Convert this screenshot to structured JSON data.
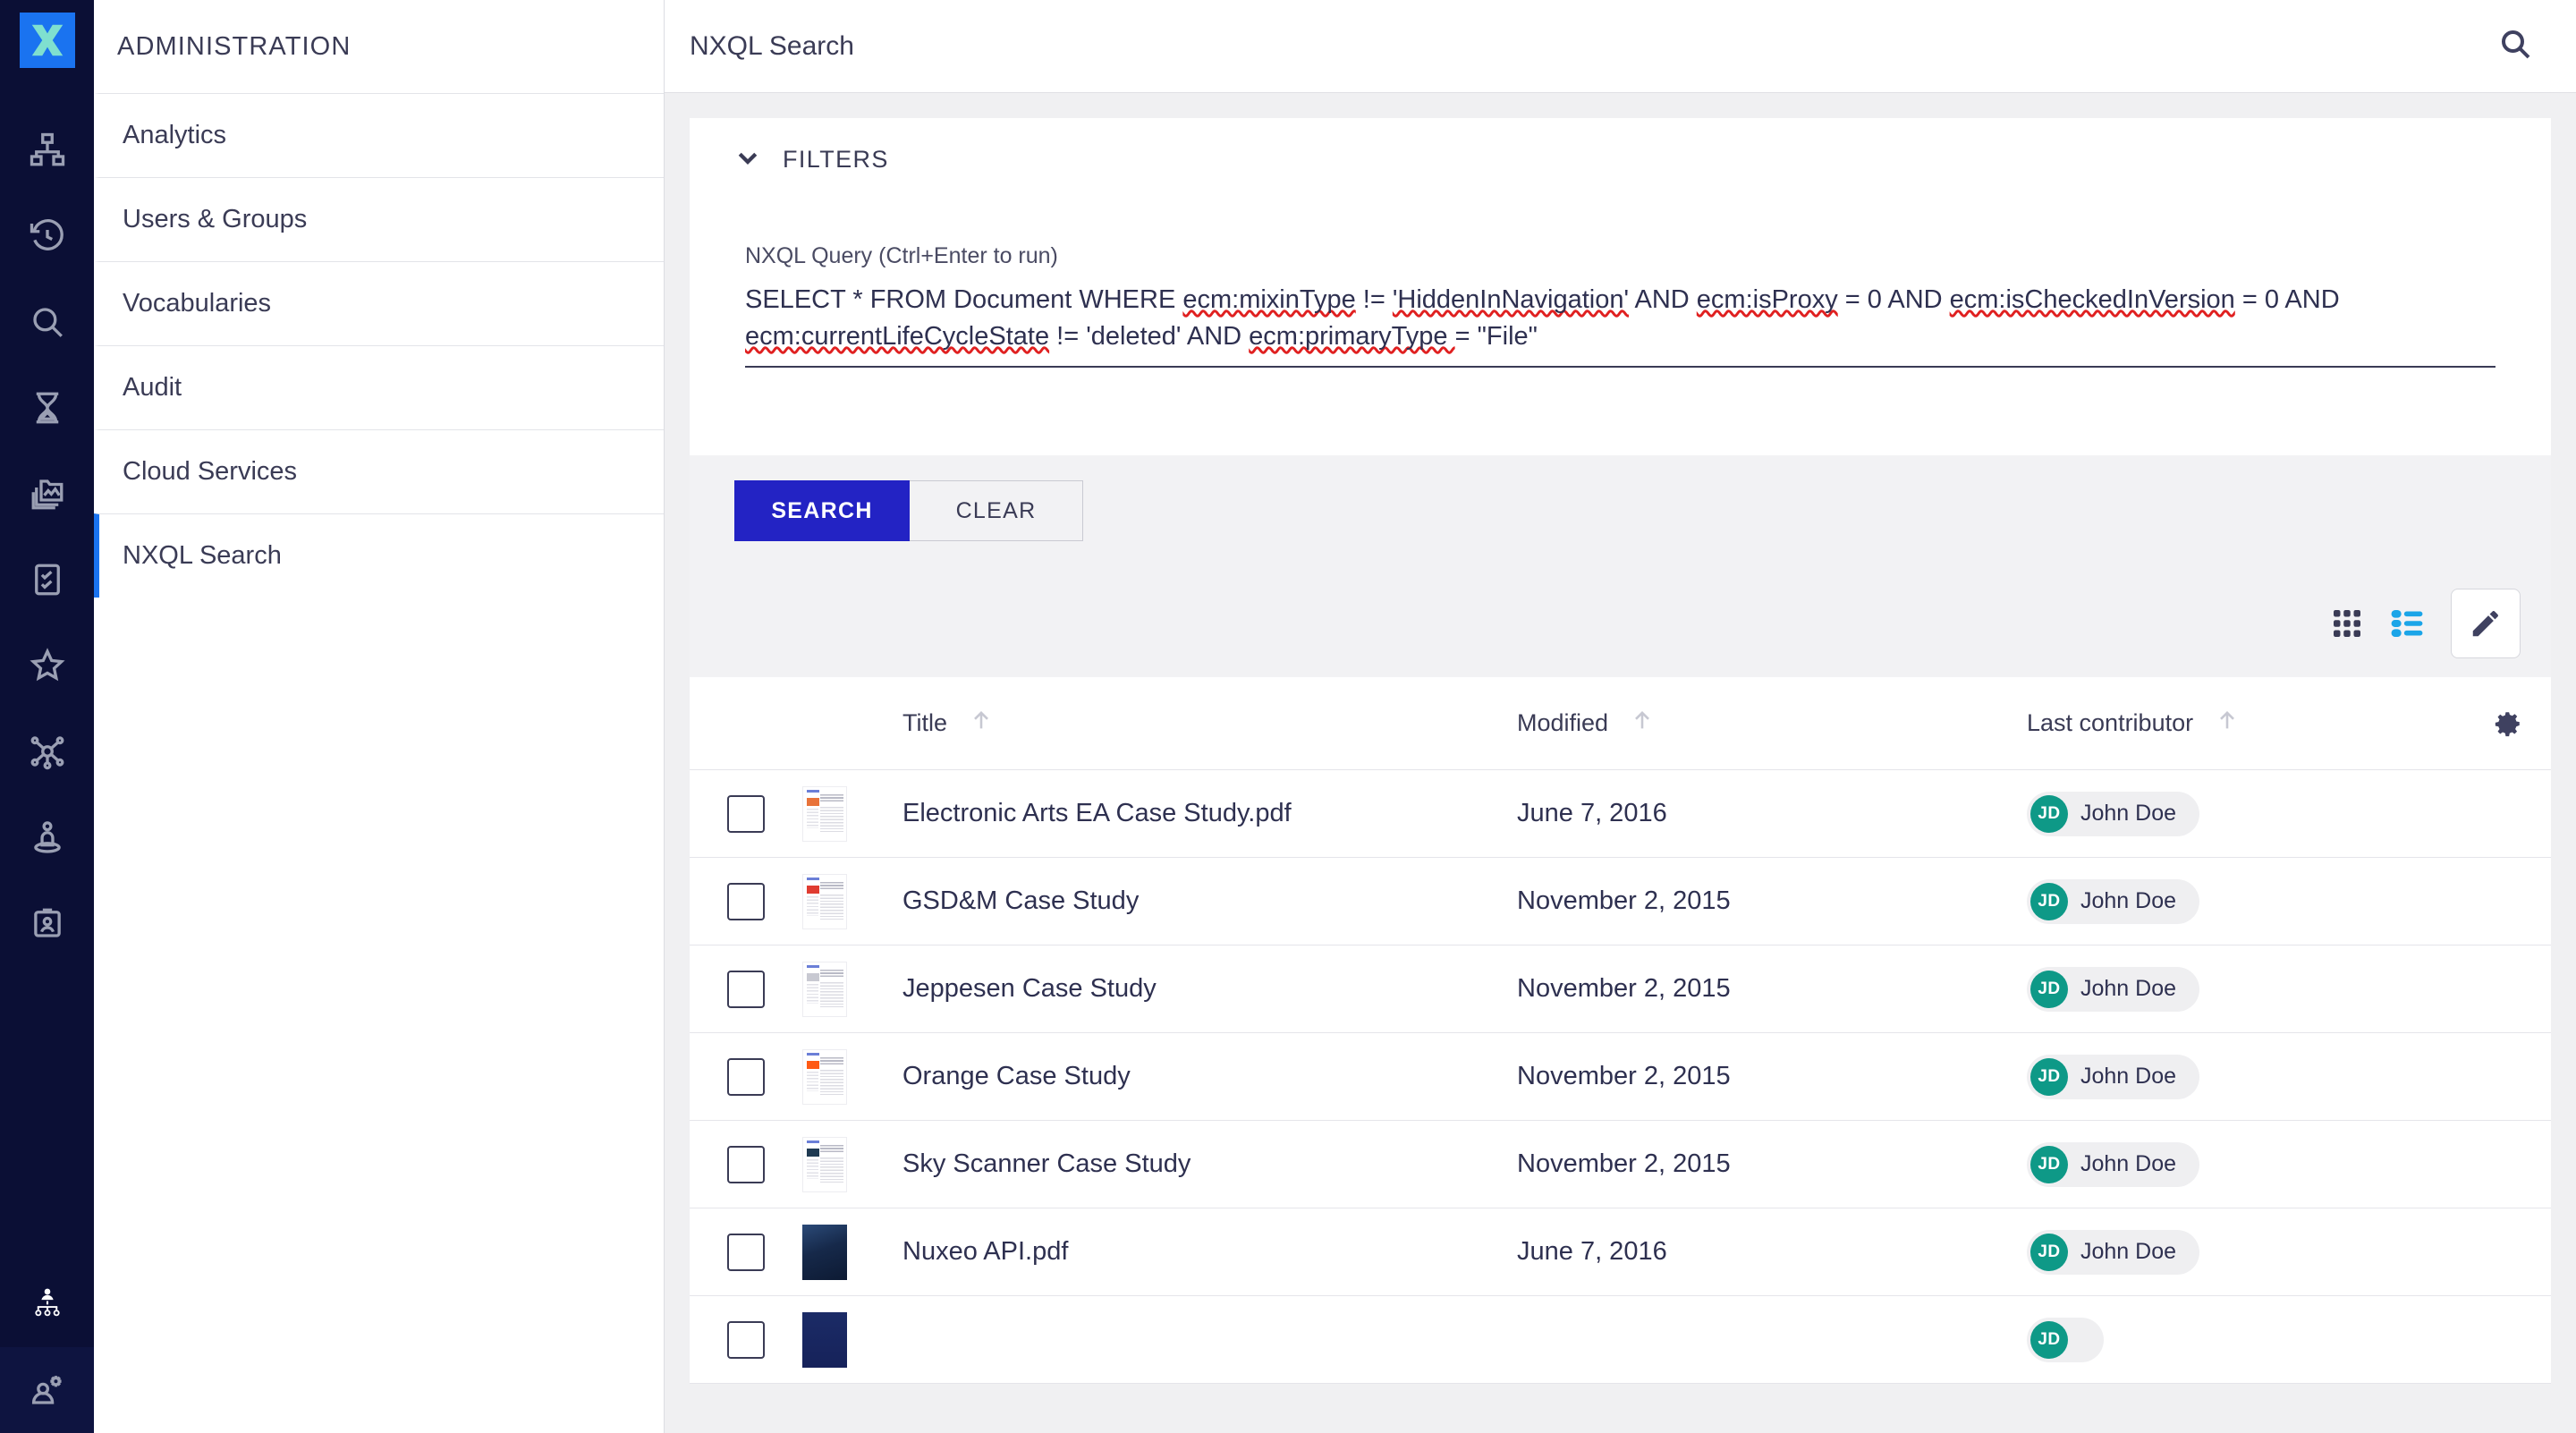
{
  "colors": {
    "rail_bg": "#0b0f35",
    "logo_bg": "#1a73f0",
    "accent_blue": "#1a73f0",
    "primary_button": "#2323c4",
    "list_active_icon": "#1ba5e8",
    "avatar_teal": "#0e9987",
    "text_dark": "#2e3050"
  },
  "rail": {
    "logo_name": "nuxeo-x-logo",
    "items": [
      {
        "icon": "sitemap-icon",
        "name": "sidebar-item-hierarchy"
      },
      {
        "icon": "history-icon",
        "name": "sidebar-item-history"
      },
      {
        "icon": "search-icon",
        "name": "sidebar-item-search"
      },
      {
        "icon": "hourglass-icon",
        "name": "sidebar-item-tasks"
      },
      {
        "icon": "image-library-icon",
        "name": "sidebar-item-assets"
      },
      {
        "icon": "checklist-icon",
        "name": "sidebar-item-checklist"
      },
      {
        "icon": "star-icon",
        "name": "sidebar-item-favorites"
      },
      {
        "icon": "network-icon",
        "name": "sidebar-item-relations"
      },
      {
        "icon": "user-location-icon",
        "name": "sidebar-item-user-location"
      },
      {
        "icon": "id-badge-icon",
        "name": "sidebar-item-id-badge"
      }
    ],
    "bottom": [
      {
        "icon": "org-chart-icon",
        "name": "rail-item-org-chart"
      },
      {
        "icon": "user-settings-icon",
        "name": "rail-item-administration"
      }
    ]
  },
  "sidebar": {
    "title": "ADMINISTRATION",
    "items": [
      {
        "label": "Analytics",
        "active": false
      },
      {
        "label": "Users & Groups",
        "active": false
      },
      {
        "label": "Vocabularies",
        "active": false
      },
      {
        "label": "Audit",
        "active": false
      },
      {
        "label": "Cloud Services",
        "active": false
      },
      {
        "label": "NXQL Search",
        "active": true
      }
    ]
  },
  "topbar": {
    "title": "NXQL Search",
    "search_icon": "search-icon"
  },
  "filters": {
    "label": "FILTERS",
    "chevron": "chevron-down-icon",
    "expanded": true
  },
  "query": {
    "label": "NXQL Query (Ctrl+Enter to run)",
    "value": "SELECT * FROM Document WHERE ecm:mixinType != 'HiddenInNavigation' AND ecm:isProxy = 0 AND ecm:isCheckedInVersion = 0 AND ecm:currentLifeCycleState != 'deleted' AND ecm:primaryType  = \"File\"",
    "tokens": [
      {
        "t": "SELECT * FROM Document WHERE ",
        "spell": false
      },
      {
        "t": "ecm:mixinType",
        "spell": true
      },
      {
        "t": " != ",
        "spell": false
      },
      {
        "t": "'HiddenInNavigation'",
        "spell": true
      },
      {
        "t": " AND ",
        "spell": false
      },
      {
        "t": "ecm:isProxy",
        "spell": true
      },
      {
        "t": " = 0 AND ",
        "spell": false
      },
      {
        "t": "ecm:isCheckedInVersion",
        "spell": true
      },
      {
        "t": " = 0 AND ",
        "spell": false
      },
      {
        "t": "ecm:currentLifeCycleState",
        "spell": true
      },
      {
        "t": " != 'deleted' AND ",
        "spell": false
      },
      {
        "t": "ecm:primaryType ",
        "spell": true
      },
      {
        "t": " = \"File\"",
        "spell": false
      }
    ]
  },
  "actions": {
    "search_label": "SEARCH",
    "clear_label": "CLEAR"
  },
  "viewbar": {
    "grid_icon": "grid-view-icon",
    "list_icon": "list-view-icon",
    "edit_icon": "pencil-icon",
    "active_view": "list"
  },
  "table": {
    "columns": [
      {
        "key": "title",
        "label": "Title",
        "sortable": true
      },
      {
        "key": "modified",
        "label": "Modified",
        "sortable": true
      },
      {
        "key": "contributor",
        "label": "Last contributor",
        "sortable": true
      }
    ],
    "settings_icon": "gear-icon",
    "rows": [
      {
        "title": "Electronic Arts EA Case Study.pdf",
        "modified": "June 7, 2016",
        "contributor": "John Doe",
        "initials": "JD",
        "thumb": "doc-orange-mark"
      },
      {
        "title": "GSD&M Case Study",
        "modified": "November 2, 2015",
        "contributor": "John Doe",
        "initials": "JD",
        "thumb": "doc-red-mark"
      },
      {
        "title": "Jeppesen Case Study",
        "modified": "November 2, 2015",
        "contributor": "John Doe",
        "initials": "JD",
        "thumb": "doc-plain"
      },
      {
        "title": "Orange Case Study",
        "modified": "November 2, 2015",
        "contributor": "John Doe",
        "initials": "JD",
        "thumb": "doc-orange-block"
      },
      {
        "title": "Sky Scanner Case Study",
        "modified": "November 2, 2015",
        "contributor": "John Doe",
        "initials": "JD",
        "thumb": "doc-dark-block"
      },
      {
        "title": "Nuxeo API.pdf",
        "modified": "June 7, 2016",
        "contributor": "John Doe",
        "initials": "JD",
        "thumb": "cover-dark-blue"
      },
      {
        "title": "",
        "modified": "",
        "contributor": "",
        "initials": "JD",
        "thumb": "cover-navy-text"
      }
    ]
  }
}
